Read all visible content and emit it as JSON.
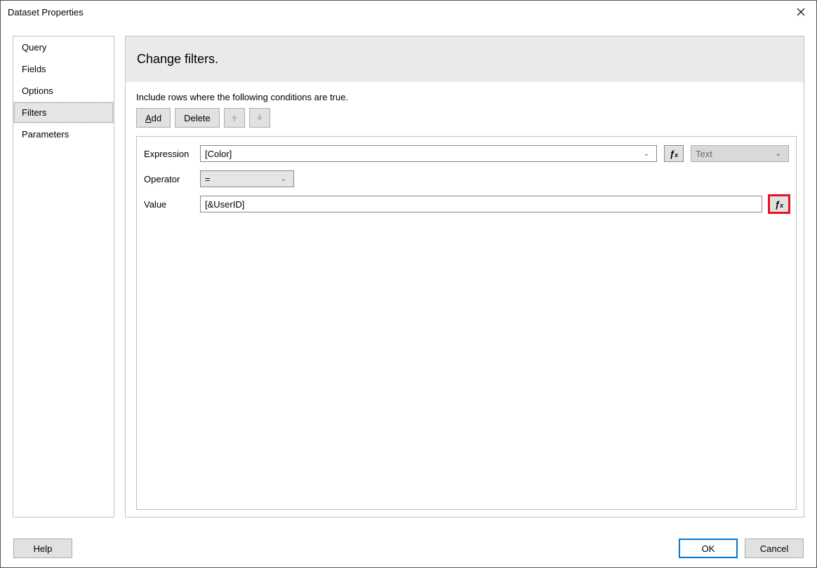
{
  "title": "Dataset Properties",
  "sidebar": {
    "items": [
      {
        "label": "Query",
        "selected": false
      },
      {
        "label": "Fields",
        "selected": false
      },
      {
        "label": "Options",
        "selected": false
      },
      {
        "label": "Filters",
        "selected": true
      },
      {
        "label": "Parameters",
        "selected": false
      }
    ]
  },
  "main": {
    "heading": "Change filters.",
    "hint": "Include rows where the following conditions are true.",
    "buttons": {
      "add": "Add",
      "delete": "Delete"
    },
    "filter": {
      "expression_label": "Expression",
      "expression_value": "[Color]",
      "type_value": "Text",
      "operator_label": "Operator",
      "operator_value": "=",
      "value_label": "Value",
      "value_value": "[&UserID]"
    }
  },
  "footer": {
    "help": "Help",
    "ok": "OK",
    "cancel": "Cancel"
  }
}
